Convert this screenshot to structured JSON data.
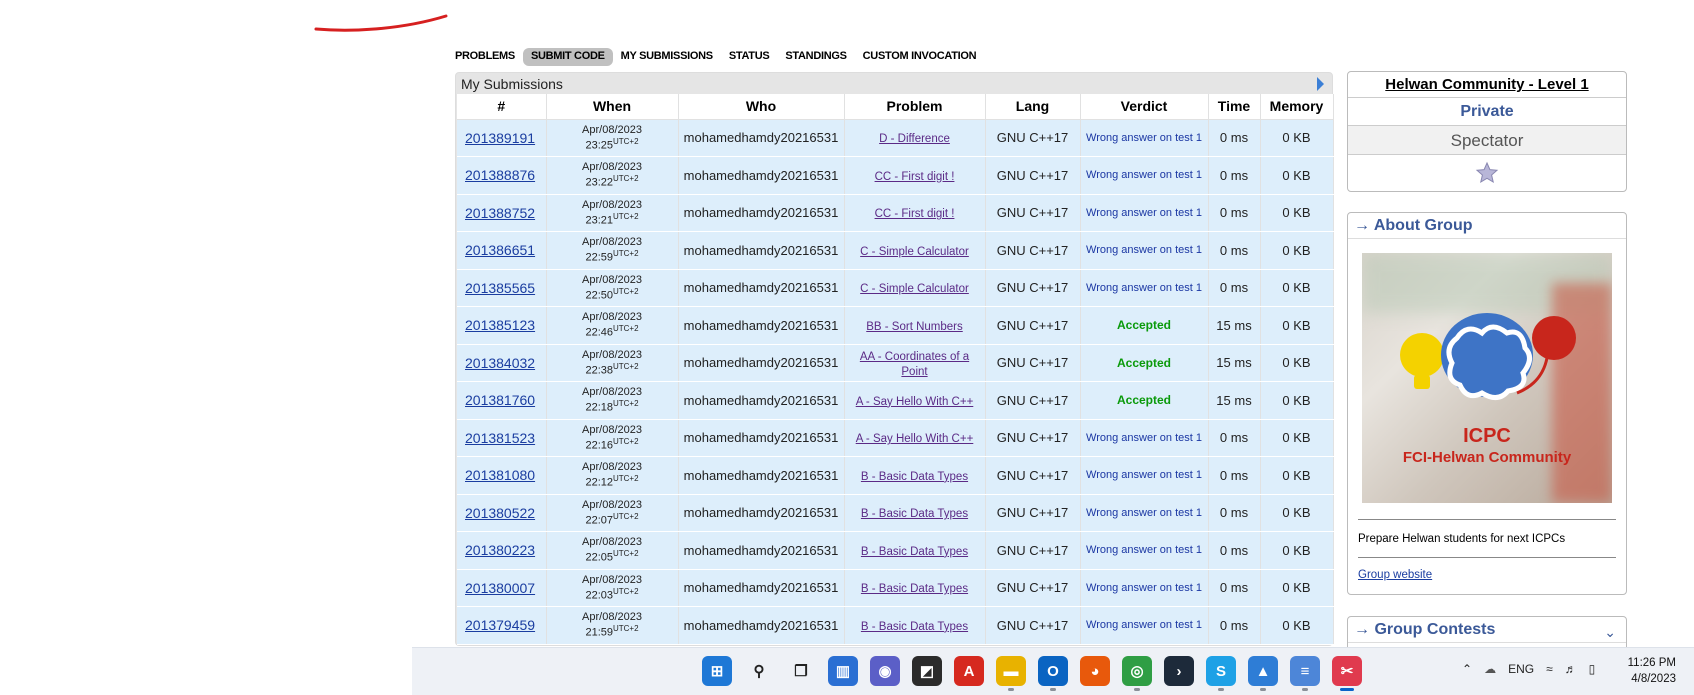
{
  "nav": {
    "items": [
      "PROBLEMS",
      "SUBMIT CODE",
      "MY SUBMISSIONS",
      "STATUS",
      "STANDINGS",
      "CUSTOM INVOCATION"
    ]
  },
  "submissions": {
    "title": "My Submissions",
    "columns": [
      "#",
      "When",
      "Who",
      "Problem",
      "Lang",
      "Verdict",
      "Time",
      "Memory"
    ],
    "tz": "UTC+2",
    "rows": [
      {
        "id": "201389191",
        "date": "Apr/08/2023",
        "time": "23:25",
        "who": "mohamedhamdy20216531",
        "problem": "D - Difference",
        "lang": "GNU C++17",
        "verdict": "Wrong answer on test 1",
        "ok": false,
        "t": "0 ms",
        "mem": "0 KB"
      },
      {
        "id": "201388876",
        "date": "Apr/08/2023",
        "time": "23:22",
        "who": "mohamedhamdy20216531",
        "problem": "CC - First digit !",
        "lang": "GNU C++17",
        "verdict": "Wrong answer on test 1",
        "ok": false,
        "t": "0 ms",
        "mem": "0 KB"
      },
      {
        "id": "201388752",
        "date": "Apr/08/2023",
        "time": "23:21",
        "who": "mohamedhamdy20216531",
        "problem": "CC - First digit !",
        "lang": "GNU C++17",
        "verdict": "Wrong answer on test 1",
        "ok": false,
        "t": "0 ms",
        "mem": "0 KB"
      },
      {
        "id": "201386651",
        "date": "Apr/08/2023",
        "time": "22:59",
        "who": "mohamedhamdy20216531",
        "problem": "C - Simple Calculator",
        "lang": "GNU C++17",
        "verdict": "Wrong answer on test 1",
        "ok": false,
        "t": "0 ms",
        "mem": "0 KB"
      },
      {
        "id": "201385565",
        "date": "Apr/08/2023",
        "time": "22:50",
        "who": "mohamedhamdy20216531",
        "problem": "C - Simple Calculator",
        "lang": "GNU C++17",
        "verdict": "Wrong answer on test 1",
        "ok": false,
        "t": "0 ms",
        "mem": "0 KB"
      },
      {
        "id": "201385123",
        "date": "Apr/08/2023",
        "time": "22:46",
        "who": "mohamedhamdy20216531",
        "problem": "BB - Sort Numbers",
        "lang": "GNU C++17",
        "verdict": "Accepted",
        "ok": true,
        "t": "15 ms",
        "mem": "0 KB"
      },
      {
        "id": "201384032",
        "date": "Apr/08/2023",
        "time": "22:38",
        "who": "mohamedhamdy20216531",
        "problem": "AA - Coordinates of a Point",
        "lang": "GNU C++17",
        "verdict": "Accepted",
        "ok": true,
        "t": "15 ms",
        "mem": "0 KB"
      },
      {
        "id": "201381760",
        "date": "Apr/08/2023",
        "time": "22:18",
        "who": "mohamedhamdy20216531",
        "problem": "A - Say Hello With C++",
        "lang": "GNU C++17",
        "verdict": "Accepted",
        "ok": true,
        "t": "15 ms",
        "mem": "0 KB"
      },
      {
        "id": "201381523",
        "date": "Apr/08/2023",
        "time": "22:16",
        "who": "mohamedhamdy20216531",
        "problem": "A - Say Hello With C++",
        "lang": "GNU C++17",
        "verdict": "Wrong answer on test 1",
        "ok": false,
        "t": "0 ms",
        "mem": "0 KB"
      },
      {
        "id": "201381080",
        "date": "Apr/08/2023",
        "time": "22:12",
        "who": "mohamedhamdy20216531",
        "problem": "B - Basic Data Types",
        "lang": "GNU C++17",
        "verdict": "Wrong answer on test 1",
        "ok": false,
        "t": "0 ms",
        "mem": "0 KB"
      },
      {
        "id": "201380522",
        "date": "Apr/08/2023",
        "time": "22:07",
        "who": "mohamedhamdy20216531",
        "problem": "B - Basic Data Types",
        "lang": "GNU C++17",
        "verdict": "Wrong answer on test 1",
        "ok": false,
        "t": "0 ms",
        "mem": "0 KB"
      },
      {
        "id": "201380223",
        "date": "Apr/08/2023",
        "time": "22:05",
        "who": "mohamedhamdy20216531",
        "problem": "B - Basic Data Types",
        "lang": "GNU C++17",
        "verdict": "Wrong answer on test 1",
        "ok": false,
        "t": "0 ms",
        "mem": "0 KB"
      },
      {
        "id": "201380007",
        "date": "Apr/08/2023",
        "time": "22:03",
        "who": "mohamedhamdy20216531",
        "problem": "B - Basic Data Types",
        "lang": "GNU C++17",
        "verdict": "Wrong answer on test 1",
        "ok": false,
        "t": "0 ms",
        "mem": "0 KB"
      },
      {
        "id": "201379459",
        "date": "Apr/08/2023",
        "time": "21:59",
        "who": "mohamedhamdy20216531",
        "problem": "B - Basic Data Types",
        "lang": "GNU C++17",
        "verdict": "Wrong answer on test 1",
        "ok": false,
        "t": "0 ms",
        "mem": "0 KB"
      }
    ]
  },
  "sidebar": {
    "group_title": "Helwan Community - Level 1",
    "privacy": "Private",
    "role": "Spectator",
    "about_header": "→ About Group",
    "logo_title": "ICPC",
    "logo_sub": "FCI-Helwan Community",
    "description": "Prepare Helwan students for next ICPCs",
    "website_link": "Group website",
    "contests_header": "→ Group Contests"
  },
  "colors": {
    "accent": "#3b5998",
    "accepted": "#0a9a0a",
    "wrong": "#1b37a3",
    "row_bg": "#ddeefb"
  },
  "taskbar": {
    "icons": [
      "windows-start-icon",
      "search-icon",
      "task-view-icon",
      "widgets-icon",
      "chat-icon",
      "sticky-notes-icon",
      "pdf-icon",
      "file-explorer-icon",
      "outlook-icon",
      "firefox-icon",
      "chrome-icon",
      "terminal-icon",
      "skype-icon",
      "photos-icon",
      "notepad-icon",
      "snipping-tool-icon"
    ],
    "language": "ENG",
    "time": "11:26 PM",
    "date": "4/8/2023"
  }
}
